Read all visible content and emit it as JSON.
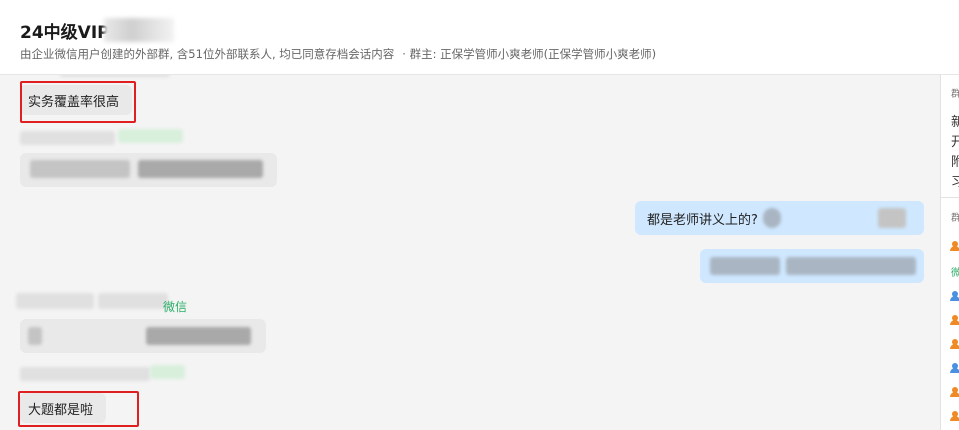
{
  "header": {
    "group_name": "24中级VIP",
    "description": "由企业微信用户创建的外部群, 含51位外部联系人, 均已同意存档会话内容",
    "owner": "· 群主: 正保学管师小爽老师(正保学管师小爽老师)"
  },
  "messages": [
    {
      "side": "left",
      "text": "实务覆盖率很高",
      "highlighted": true
    },
    {
      "side": "right",
      "text": "都是老师讲义上的?"
    },
    {
      "side": "left",
      "sender_suffix": "微信"
    },
    {
      "side": "left",
      "text": "大题都是啦",
      "highlighted": true
    }
  ],
  "right_panel": {
    "section_label_1": "群",
    "notice_lines": [
      "新",
      "开",
      "附",
      "习"
    ],
    "section_label_2": "群",
    "wechat_label": "微"
  },
  "colors": {
    "highlight_border": "#e02020",
    "right_bubble": "#cfe8ff",
    "left_bubble": "#e9e9e9",
    "wechat_green": "#2aae67"
  }
}
